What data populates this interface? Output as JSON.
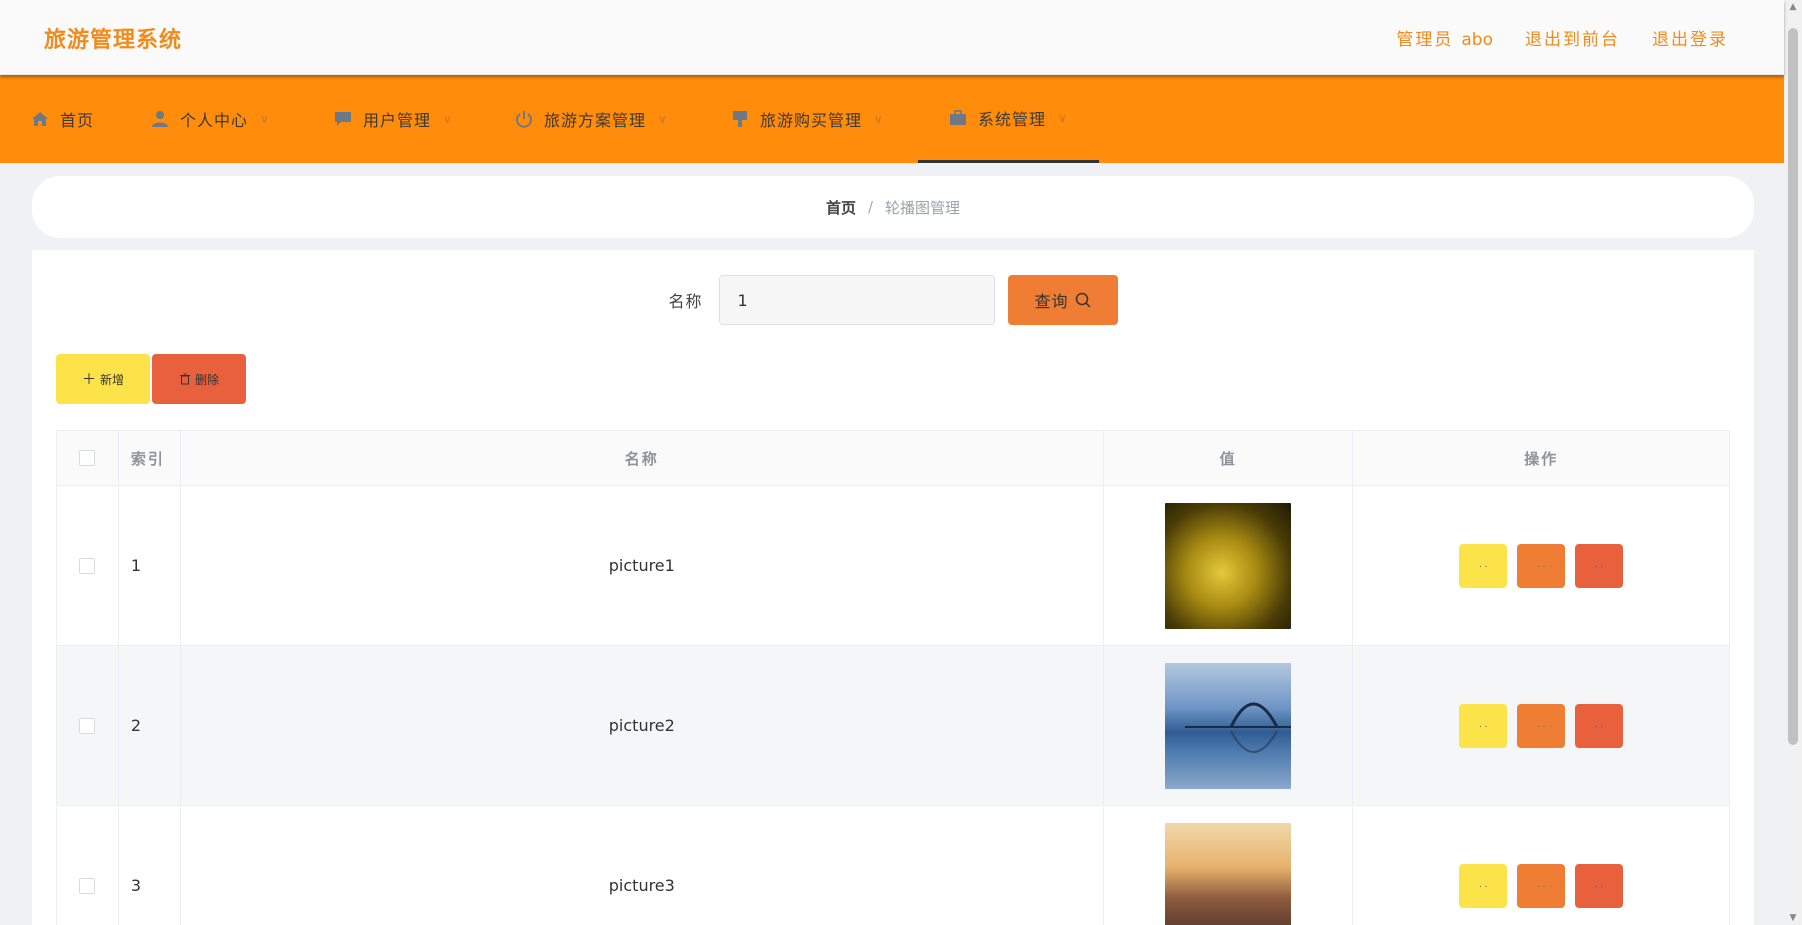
{
  "header": {
    "title": "旅游管理系统",
    "role_label": "管理员",
    "admin_name": "abo",
    "exit_front_label": "退出到前台",
    "logout_label": "退出登录"
  },
  "nav": {
    "items": [
      {
        "label": "首页",
        "icon": "home-icon"
      },
      {
        "label": "个人中心",
        "icon": "user-icon"
      },
      {
        "label": "用户管理",
        "icon": "chat-icon"
      },
      {
        "label": "旅游方案管理",
        "icon": "power-icon"
      },
      {
        "label": "旅游购买管理",
        "icon": "pin-icon"
      },
      {
        "label": "系统管理",
        "icon": "briefcase-icon"
      }
    ],
    "active_index": 5,
    "accent_color": "#ff8c0a"
  },
  "breadcrumb": {
    "home": "首页",
    "separator": "/",
    "current": "轮播图管理"
  },
  "search": {
    "label": "名称",
    "value": "1",
    "button_label": "查询"
  },
  "actions": {
    "add_label": "新增",
    "delete_label": "删除"
  },
  "table": {
    "columns": [
      "索引",
      "名称",
      "值",
      "操作"
    ],
    "rows": [
      {
        "index": "1",
        "name": "picture1",
        "image": "golden-abstract-thumbnail"
      },
      {
        "index": "2",
        "name": "picture2",
        "image": "bridge-lake-thumbnail"
      },
      {
        "index": "3",
        "name": "picture3",
        "image": "city-sunset-thumbnail"
      }
    ],
    "op_labels": [
      "·  ·",
      "·  ·",
      "·  ·"
    ]
  },
  "colors": {
    "brand": "#f08b1e",
    "yellow_button": "#fbe349",
    "orange_button": "#ef7d33",
    "red_button": "#e8613c"
  }
}
